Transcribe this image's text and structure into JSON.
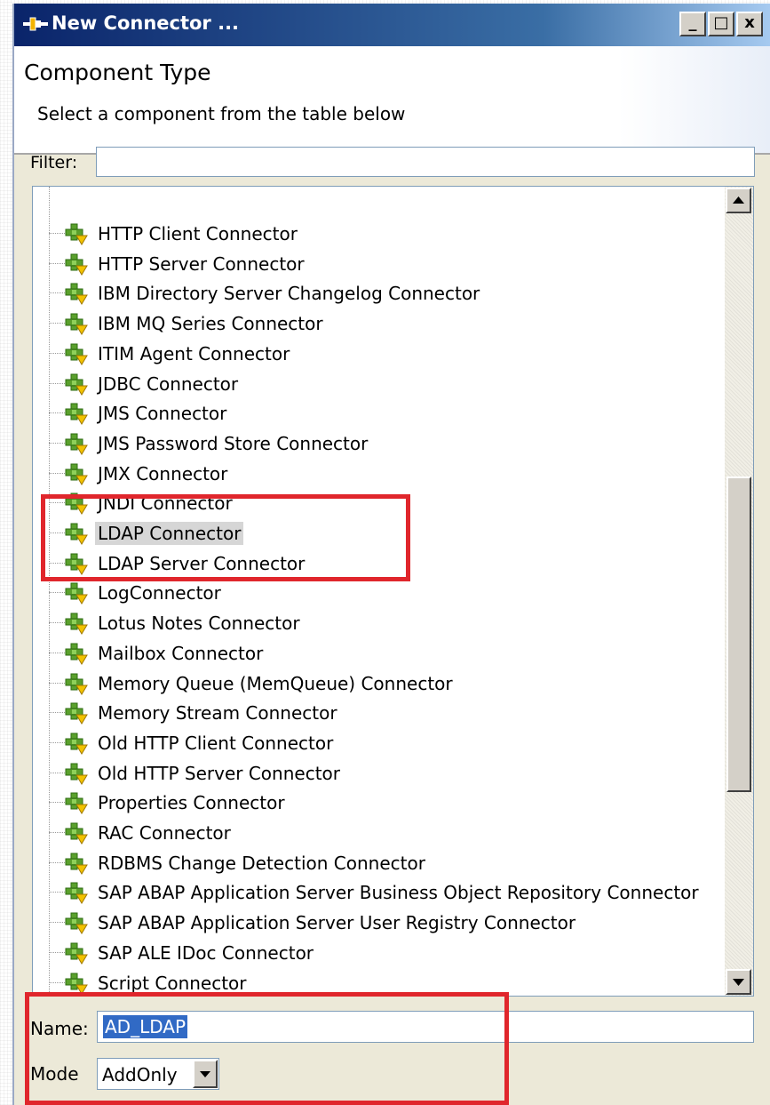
{
  "window": {
    "title": "New Connector ...",
    "controls": {
      "minimize": "_",
      "maximize": "□",
      "close": "x"
    }
  },
  "header": {
    "title": "Component Type",
    "description": "Select a component from the table below"
  },
  "filter": {
    "label": "Filter:",
    "value": ""
  },
  "tree": {
    "items": [
      "HTTP Client Connector",
      "HTTP Server Connector",
      "IBM Directory Server Changelog Connector",
      "IBM MQ Series Connector",
      "ITIM Agent Connector",
      "JDBC Connector",
      "JMS Connector",
      "JMS Password Store Connector",
      "JMX Connector",
      "JNDI Connector",
      "LDAP Connector",
      "LDAP Server Connector",
      "LogConnector",
      "Lotus Notes Connector",
      "Mailbox Connector",
      "Memory Queue (MemQueue) Connector",
      "Memory Stream Connector",
      "Old HTTP Client Connector",
      "Old HTTP Server Connector",
      "Properties Connector",
      "RAC Connector",
      "RDBMS Change Detection Connector",
      "SAP ABAP Application Server Business Object Repository Connector",
      "SAP ABAP Application Server User Registry Connector",
      "SAP ALE IDoc Connector",
      "Script Connector"
    ],
    "selected": "LDAP Connector"
  },
  "name_field": {
    "label": "Name:",
    "value": "AD_LDAP"
  },
  "mode_field": {
    "label": "Mode",
    "value": "AddOnly"
  },
  "colors": {
    "highlight": "#e0262c",
    "selection": "#316ac5",
    "titlebar": "#0a246a"
  },
  "icons": {
    "title": "connector-plug-icon",
    "tree_item": "connector-plus-icon",
    "scroll_up": "arrow-up-icon",
    "scroll_down": "arrow-down-icon",
    "dropdown": "chevron-down-icon"
  }
}
